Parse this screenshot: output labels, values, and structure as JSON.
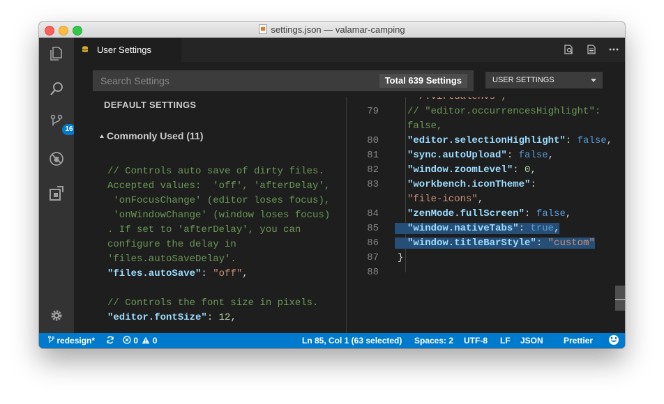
{
  "window": {
    "title": "settings.json — valamar-camping"
  },
  "activity_bar": {
    "items": [
      {
        "icon": "files-icon"
      },
      {
        "icon": "search-icon"
      },
      {
        "icon": "source-control-icon",
        "badge": "16"
      },
      {
        "icon": "debug-icon"
      },
      {
        "icon": "extensions-icon"
      }
    ],
    "bottom_icon": "gear-icon"
  },
  "tabs": [
    {
      "label": "User Settings",
      "icon": "settings-file-icon",
      "active": true
    }
  ],
  "tab_actions": [
    "open-json-icon",
    "split-editor-icon",
    "more-icon"
  ],
  "search": {
    "placeholder": "Search Settings",
    "value": "",
    "count_label": "Total 639 Settings"
  },
  "scope_select": {
    "selected": "USER SETTINGS"
  },
  "left_pane": {
    "header": "DEFAULT SETTINGS",
    "section_title": "Commonly Used (11)",
    "lines": [
      [
        {
          "t": "// Controls auto save of dirty files.",
          "c": "comment"
        }
      ],
      [
        {
          "t": "Accepted values:  'off', 'afterDelay',",
          "c": "comment"
        }
      ],
      [
        {
          "t": " 'onFocusChange' (editor loses focus),",
          "c": "comment"
        }
      ],
      [
        {
          "t": " 'onWindowChange' (window loses focus)",
          "c": "comment"
        }
      ],
      [
        {
          "t": ". If set to 'afterDelay', you can",
          "c": "comment"
        }
      ],
      [
        {
          "t": "configure the delay in",
          "c": "comment"
        }
      ],
      [
        {
          "t": "'files.autoSaveDelay'.",
          "c": "comment"
        }
      ],
      [
        {
          "t": "\"files.autoSave\"",
          "c": "key"
        },
        {
          "t": ": ",
          "c": "punc"
        },
        {
          "t": "\"off\"",
          "c": "str"
        },
        {
          "t": ",",
          "c": "punc"
        }
      ],
      [
        {
          "t": "",
          "c": "punc"
        }
      ],
      [
        {
          "t": "// Controls the font size in pixels.",
          "c": "comment"
        }
      ],
      [
        {
          "t": "\"editor.fontSize\"",
          "c": "key"
        },
        {
          "t": ": ",
          "c": "punc"
        },
        {
          "t": "12",
          "c": "num"
        },
        {
          "t": ",",
          "c": "punc"
        }
      ]
    ]
  },
  "right_pane": {
    "lines": [
      {
        "n": "",
        "parts": [
          {
            "t": "\"~/.virtualenvs\",",
            "c": "str"
          }
        ]
      },
      {
        "n": "79",
        "parts": [
          {
            "t": "// \"editor.occurrencesHighlight\":",
            "c": "comment"
          }
        ]
      },
      {
        "n": "",
        "parts": [
          {
            "t": "false,",
            "c": "comment"
          }
        ]
      },
      {
        "n": "80",
        "parts": [
          {
            "t": "\"editor.selectionHighlight\"",
            "c": "key"
          },
          {
            "t": ": ",
            "c": "punc"
          },
          {
            "t": "false",
            "c": "kw"
          },
          {
            "t": ",",
            "c": "punc"
          }
        ]
      },
      {
        "n": "81",
        "parts": [
          {
            "t": "\"sync.autoUpload\"",
            "c": "key"
          },
          {
            "t": ": ",
            "c": "punc"
          },
          {
            "t": "false",
            "c": "kw"
          },
          {
            "t": ",",
            "c": "punc"
          }
        ]
      },
      {
        "n": "82",
        "parts": [
          {
            "t": "\"window.zoomLevel\"",
            "c": "key"
          },
          {
            "t": ": ",
            "c": "punc"
          },
          {
            "t": "0",
            "c": "num"
          },
          {
            "t": ",",
            "c": "punc"
          }
        ]
      },
      {
        "n": "83",
        "parts": [
          {
            "t": "\"workbench.iconTheme\"",
            "c": "key"
          },
          {
            "t": ":",
            "c": "punc"
          }
        ]
      },
      {
        "n": "",
        "parts": [
          {
            "t": "\"file-icons\"",
            "c": "str"
          },
          {
            "t": ",",
            "c": "punc"
          }
        ]
      },
      {
        "n": "84",
        "parts": [
          {
            "t": "\"zenMode.fullScreen\"",
            "c": "key"
          },
          {
            "t": ": ",
            "c": "punc"
          },
          {
            "t": "false",
            "c": "kw"
          },
          {
            "t": ",",
            "c": "punc"
          }
        ]
      },
      {
        "n": "85",
        "sel": true,
        "parts": [
          {
            "t": "\"window.nativeTabs\"",
            "c": "key"
          },
          {
            "t": ": ",
            "c": "punc"
          },
          {
            "t": "true",
            "c": "kw"
          },
          {
            "t": ",",
            "c": "punc"
          }
        ]
      },
      {
        "n": "86",
        "sel": true,
        "parts": [
          {
            "t": "\"window.titleBarStyle\"",
            "c": "key"
          },
          {
            "t": ": ",
            "c": "punc"
          },
          {
            "t": "\"custom\"",
            "c": "str"
          }
        ]
      },
      {
        "n": "87",
        "outer": true,
        "parts": [
          {
            "t": "}",
            "c": "punc"
          }
        ]
      },
      {
        "n": "88",
        "outer": true,
        "parts": [
          {
            "t": "",
            "c": "punc"
          }
        ]
      }
    ]
  },
  "status_bar": {
    "branch": "redesign*",
    "errors": "0",
    "warnings": "0",
    "cursor": "Ln 85, Col 1 (63 selected)",
    "indent": "Spaces: 2",
    "encoding": "UTF-8",
    "eol": "LF",
    "language": "JSON",
    "formatter": "Prettier"
  },
  "colors": {
    "accent": "#007acc",
    "editor_bg": "#1e1e1e",
    "activity_bar": "#333333",
    "selection": "#264f78"
  }
}
